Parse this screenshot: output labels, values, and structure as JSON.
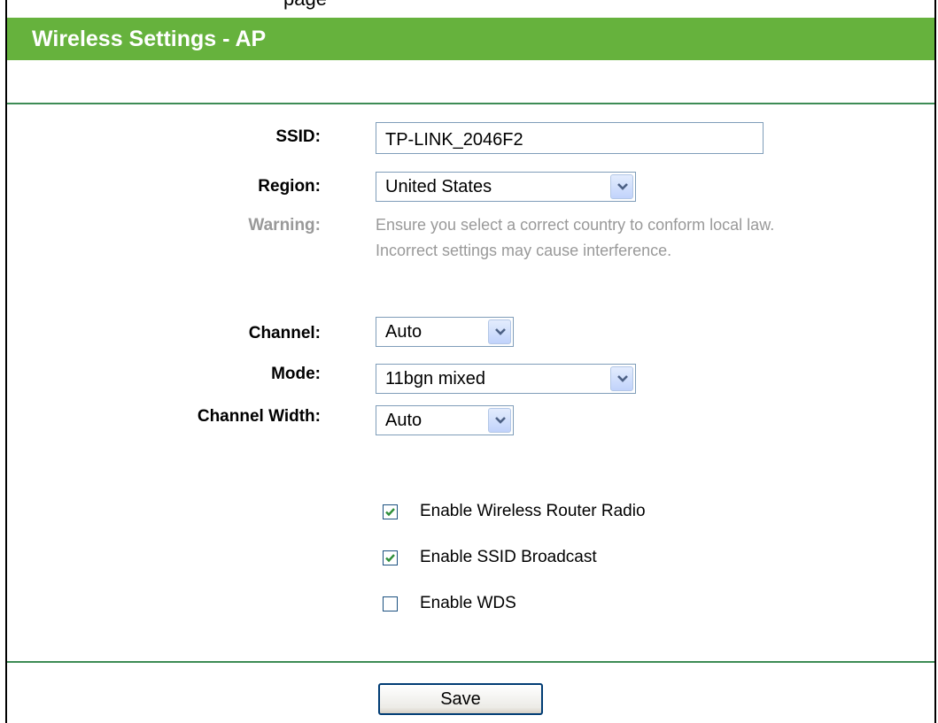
{
  "header": {
    "clipped_text": "page",
    "title": "Wireless Settings - AP"
  },
  "form": {
    "ssid": {
      "label": "SSID:",
      "value": "TP-LINK_2046F2"
    },
    "region": {
      "label": "Region:",
      "value": "United States"
    },
    "warning": {
      "label": "Warning:",
      "line1": "Ensure you select a correct country to conform local law.",
      "line2": "Incorrect settings may cause interference."
    },
    "channel": {
      "label": "Channel:",
      "value": "Auto"
    },
    "mode": {
      "label": "Mode:",
      "value": "11bgn mixed"
    },
    "channel_width": {
      "label": "Channel Width:",
      "value": "Auto"
    }
  },
  "options": [
    {
      "label": "Enable Wireless Router Radio",
      "checked": true
    },
    {
      "label": "Enable SSID Broadcast",
      "checked": true
    },
    {
      "label": "Enable WDS",
      "checked": false
    }
  ],
  "actions": {
    "save_label": "Save"
  },
  "colors": {
    "title_bar": "#66b23d",
    "divider": "#3d8c55",
    "warning_text": "#999999",
    "check_mark": "#2f8f3a"
  },
  "icons": {
    "dropdown": "chevron-down-icon",
    "check": "check-icon"
  }
}
